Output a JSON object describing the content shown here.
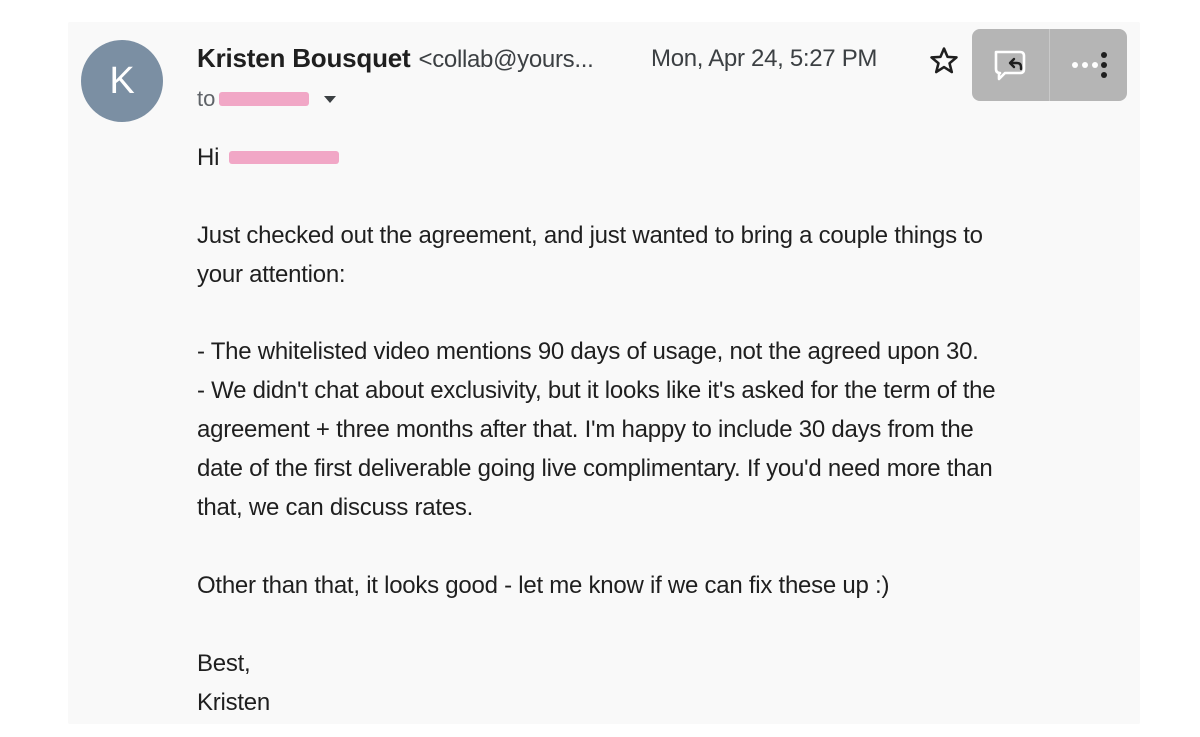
{
  "sender": {
    "avatar_letter": "K",
    "name": "Kristen Bousquet",
    "email": "<collab@yours...",
    "timestamp": "Mon, Apr 24, 5:27 PM"
  },
  "recipient": {
    "to_label": "to"
  },
  "icons": {
    "star": "star-outline-icon",
    "reply": "reply-icon",
    "more": "more-vert-icon",
    "caret": "chevron-down-icon"
  },
  "colors": {
    "avatar": "#7b8fa3",
    "redaction": "#f1a7c6",
    "action_box": "#b5b5b5"
  },
  "body": {
    "greeting": "Hi",
    "paragraph1": [
      "Just checked out the agreement, and just wanted to bring a couple things to",
      "your attention:"
    ],
    "bullets": [
      "- The whitelisted video mentions 90 days of usage, not the agreed upon 30.",
      "- We didn't chat about exclusivity, but it looks like it's asked for the term of the",
      "agreement + three months after that. I'm happy to include 30 days from the",
      "date of the first deliverable going live complimentary. If you'd need more than",
      "that, we can discuss rates."
    ],
    "paragraph3": "Other than that, it looks good - let me know if we can fix these up :)",
    "signoff": "Best,",
    "signature": "Kristen"
  }
}
